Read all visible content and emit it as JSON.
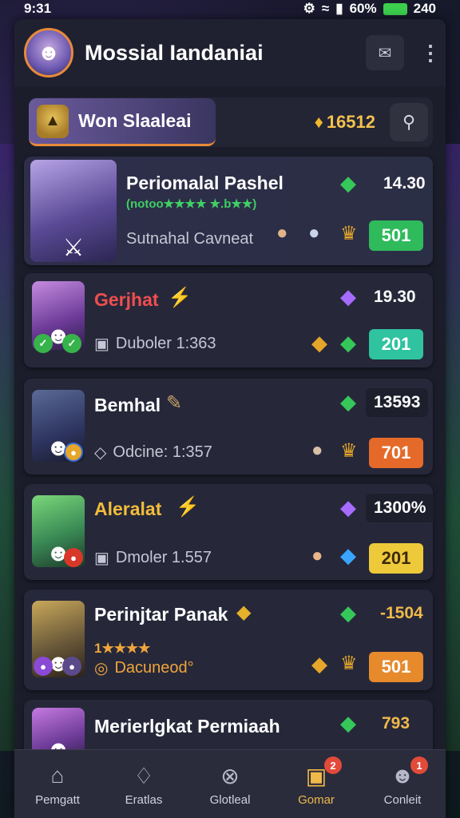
{
  "status": {
    "time": "9:31",
    "battery_pct": "60%",
    "battery_right": "240"
  },
  "header": {
    "title": "Mossial Iandaniai"
  },
  "toolbar": {
    "league_label": "Won Slaaleai",
    "coins": "16512"
  },
  "cards": [
    {
      "name": "Periomalal Pashel",
      "stars_line": "(notoo★★★★ ★.b★★)",
      "sub": "Sutnahal Cavneat",
      "score": "14.30",
      "price": "501"
    },
    {
      "name": "Gerjhat",
      "sub": "Duboler 1:363",
      "score": "19.30",
      "price": "201"
    },
    {
      "name": "Bemhal",
      "sub": "Odcine: 1:357",
      "score": "13593",
      "price": "701"
    },
    {
      "name": "Aleralat",
      "sub": "Dmoler 1.557",
      "score": "1300%",
      "price": "201"
    },
    {
      "name": "Perinjtar Panak",
      "stars_line": "1★★★★",
      "sub": "Dacuneod°",
      "score": "-1504",
      "price": "501"
    },
    {
      "name": "Merierlgkat Permiaah",
      "score": "793"
    }
  ],
  "nav": [
    {
      "label": "Pemgatt",
      "icon": "home-icon"
    },
    {
      "label": "Eratlas",
      "icon": "bag-icon"
    },
    {
      "label": "Glotleal",
      "icon": "close-circle-icon"
    },
    {
      "label": "Gomar",
      "icon": "chest-icon",
      "badge": "2"
    },
    {
      "label": "Conleit",
      "icon": "profile-icon",
      "badge": "1"
    }
  ]
}
